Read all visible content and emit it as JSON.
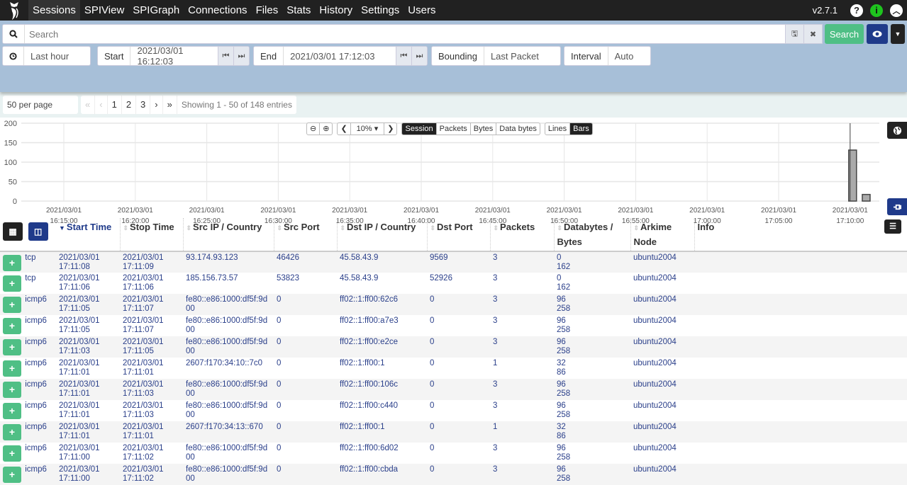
{
  "nav": {
    "items": [
      "Sessions",
      "SPIView",
      "SPIGraph",
      "Connections",
      "Files",
      "Stats",
      "History",
      "Settings",
      "Users"
    ],
    "active": "Sessions",
    "version": "v2.7.1"
  },
  "search": {
    "placeholder": "Search",
    "value": "",
    "search_label": "Search"
  },
  "time": {
    "range": "Last hour",
    "start_label": "Start",
    "start": "2021/03/01 16:12:03",
    "end_label": "End",
    "end": "2021/03/01 17:12:03",
    "bounding_label": "Bounding",
    "bounding": "Last Packet",
    "interval_label": "Interval",
    "interval": "Auto"
  },
  "pagination": {
    "per_page": "50 per page",
    "first": "«",
    "prev": "‹",
    "pages": [
      "1",
      "2",
      "3"
    ],
    "next": "›",
    "last": "»",
    "showing": "Showing 1 - 50 of 148 entries"
  },
  "chart_controls": {
    "zoom_level": "10%",
    "metrics": [
      "Session",
      "Packets",
      "Bytes",
      "Data bytes"
    ],
    "active_metric": "Session",
    "styles": [
      "Lines",
      "Bars"
    ],
    "active_style": "Bars"
  },
  "chart_data": {
    "type": "bar",
    "title": "",
    "xlabel": "",
    "ylabel": "",
    "ylim": [
      0,
      200
    ],
    "yticks": [
      "200",
      "150",
      "100",
      "50",
      "0"
    ],
    "xticks": [
      [
        "2021/03/01",
        "16:15:00"
      ],
      [
        "2021/03/01",
        "16:20:00"
      ],
      [
        "2021/03/01",
        "16:25:00"
      ],
      [
        "2021/03/01",
        "16:30:00"
      ],
      [
        "2021/03/01",
        "16:35:00"
      ],
      [
        "2021/03/01",
        "16:40:00"
      ],
      [
        "2021/03/01",
        "16:45:00"
      ],
      [
        "2021/03/01",
        "16:50:00"
      ],
      [
        "2021/03/01",
        "16:55:00"
      ],
      [
        "2021/03/01",
        "17:00:00"
      ],
      [
        "2021/03/01",
        "17:05:00"
      ],
      [
        "2021/03/01",
        "17:10:00"
      ]
    ],
    "categories": [
      "17:10:00",
      "17:11:00"
    ],
    "values": [
      131,
      17
    ],
    "grid": true
  },
  "table": {
    "columns": [
      "Start Time",
      "Stop Time",
      "Src IP / Country",
      "Src Port",
      "Dst IP / Country",
      "Dst Port",
      "Packets",
      "Databytes / Bytes",
      "Arkime Node",
      "Info"
    ],
    "sorted_column": "Start Time",
    "rows": [
      {
        "proto": "tcp",
        "start": [
          "2021/03/01",
          "17:11:08"
        ],
        "stop": [
          "2021/03/01",
          "17:11:09"
        ],
        "src": "93.174.93.123",
        "sport": "46426",
        "dst": "45.58.43.9",
        "dport": "9569",
        "packets": "3",
        "bytes": [
          "0",
          "162"
        ],
        "node": "ubuntu2004"
      },
      {
        "proto": "tcp",
        "start": [
          "2021/03/01",
          "17:11:06"
        ],
        "stop": [
          "2021/03/01",
          "17:11:06"
        ],
        "src": "185.156.73.57",
        "sport": "53823",
        "dst": "45.58.43.9",
        "dport": "52926",
        "packets": "3",
        "bytes": [
          "0",
          "162"
        ],
        "node": "ubuntu2004"
      },
      {
        "proto": "icmp6",
        "start": [
          "2021/03/01",
          "17:11:05"
        ],
        "stop": [
          "2021/03/01",
          "17:11:07"
        ],
        "src": "fe80::e86:1000:df5f:9d00",
        "sport": "0",
        "dst": "ff02::1:ff00:62c6",
        "dport": "0",
        "packets": "3",
        "bytes": [
          "96",
          "258"
        ],
        "node": "ubuntu2004"
      },
      {
        "proto": "icmp6",
        "start": [
          "2021/03/01",
          "17:11:05"
        ],
        "stop": [
          "2021/03/01",
          "17:11:07"
        ],
        "src": "fe80::e86:1000:df5f:9d00",
        "sport": "0",
        "dst": "ff02::1:ff00:a7e3",
        "dport": "0",
        "packets": "3",
        "bytes": [
          "96",
          "258"
        ],
        "node": "ubuntu2004"
      },
      {
        "proto": "icmp6",
        "start": [
          "2021/03/01",
          "17:11:03"
        ],
        "stop": [
          "2021/03/01",
          "17:11:05"
        ],
        "src": "fe80::e86:1000:df5f:9d00",
        "sport": "0",
        "dst": "ff02::1:ff00:e2ce",
        "dport": "0",
        "packets": "3",
        "bytes": [
          "96",
          "258"
        ],
        "node": "ubuntu2004"
      },
      {
        "proto": "icmp6",
        "start": [
          "2021/03/01",
          "17:11:01"
        ],
        "stop": [
          "2021/03/01",
          "17:11:01"
        ],
        "src": "2607:f170:34:10::7c0",
        "sport": "0",
        "dst": "ff02::1:ff00:1",
        "dport": "0",
        "packets": "1",
        "bytes": [
          "32",
          "86"
        ],
        "node": "ubuntu2004"
      },
      {
        "proto": "icmp6",
        "start": [
          "2021/03/01",
          "17:11:01"
        ],
        "stop": [
          "2021/03/01",
          "17:11:03"
        ],
        "src": "fe80::e86:1000:df5f:9d00",
        "sport": "0",
        "dst": "ff02::1:ff00:106c",
        "dport": "0",
        "packets": "3",
        "bytes": [
          "96",
          "258"
        ],
        "node": "ubuntu2004"
      },
      {
        "proto": "icmp6",
        "start": [
          "2021/03/01",
          "17:11:01"
        ],
        "stop": [
          "2021/03/01",
          "17:11:03"
        ],
        "src": "fe80::e86:1000:df5f:9d00",
        "sport": "0",
        "dst": "ff02::1:ff00:c440",
        "dport": "0",
        "packets": "3",
        "bytes": [
          "96",
          "258"
        ],
        "node": "ubuntu2004"
      },
      {
        "proto": "icmp6",
        "start": [
          "2021/03/01",
          "17:11:01"
        ],
        "stop": [
          "2021/03/01",
          "17:11:01"
        ],
        "src": "2607:f170:34:13::670",
        "sport": "0",
        "dst": "ff02::1:ff00:1",
        "dport": "0",
        "packets": "1",
        "bytes": [
          "32",
          "86"
        ],
        "node": "ubuntu2004"
      },
      {
        "proto": "icmp6",
        "start": [
          "2021/03/01",
          "17:11:00"
        ],
        "stop": [
          "2021/03/01",
          "17:11:02"
        ],
        "src": "fe80::e86:1000:df5f:9d00",
        "sport": "0",
        "dst": "ff02::1:ff00:6d02",
        "dport": "0",
        "packets": "3",
        "bytes": [
          "96",
          "258"
        ],
        "node": "ubuntu2004"
      },
      {
        "proto": "icmp6",
        "start": [
          "2021/03/01",
          "17:11:00"
        ],
        "stop": [
          "2021/03/01",
          "17:11:02"
        ],
        "src": "fe80::e86:1000:df5f:9d00",
        "sport": "0",
        "dst": "ff02::1:ff00:cbda",
        "dport": "0",
        "packets": "3",
        "bytes": [
          "96",
          "258"
        ],
        "node": "ubuntu2004"
      }
    ]
  }
}
